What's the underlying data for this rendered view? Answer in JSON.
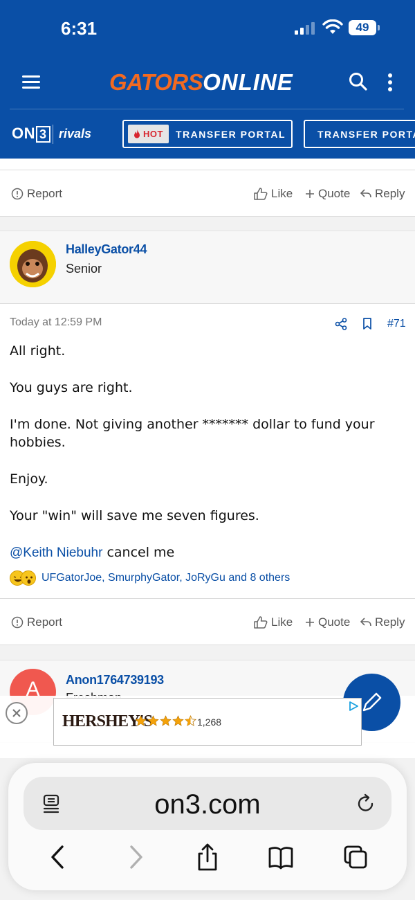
{
  "status_bar": {
    "time": "6:31",
    "battery": "49"
  },
  "header": {
    "logo_gators": "GATORS",
    "logo_online": "ONLINE",
    "brand_on3": "ON",
    "brand_on3_three": "3",
    "brand_rivals": "rivals",
    "hot_badge": "HOT",
    "pill_1": "TRANSFER PORTAL",
    "pill_2": "TRANSFER PORTAL"
  },
  "actions": {
    "report": "Report",
    "like": "Like",
    "quote": "Quote",
    "reply": "Reply"
  },
  "post": {
    "username": "HalleyGator44",
    "user_title": "Senior",
    "timestamp": "Today at 12:59 PM",
    "number": "#71",
    "body": [
      "All right.",
      "You guys are right.",
      "I'm done. Not giving another ******* dollar to fund your hobbies.",
      "Enjoy.",
      "Your \"win\" will save me seven figures."
    ],
    "mention": "@Keith Niebuhr",
    "mention_suffix": " cancel me",
    "reactions_text": "UFGatorJoe, SmurphyGator, JoRyGu and 8 others"
  },
  "next_post": {
    "username": "Anon1764739193",
    "user_title": "Freshman",
    "avatar_letter": "A"
  },
  "ad": {
    "brand": "HERSHEY'S",
    "rating_count": "1,268",
    "stars": 4.5
  },
  "browser": {
    "url": "on3.com"
  },
  "colors": {
    "header_bg": "#0a4fa6",
    "accent_orange": "#f26a21",
    "link_blue": "#0a4fa6"
  }
}
